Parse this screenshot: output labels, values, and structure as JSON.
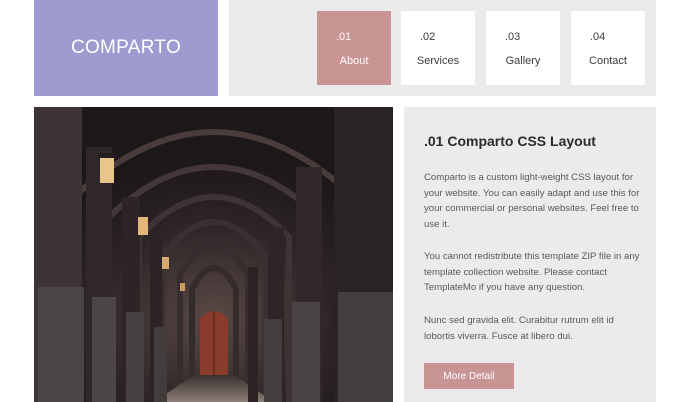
{
  "logo": {
    "text": "COMPARTO"
  },
  "nav": {
    "items": [
      {
        "number": ".01",
        "label": "About",
        "active": true
      },
      {
        "number": ".02",
        "label": "Services",
        "active": false
      },
      {
        "number": ".03",
        "label": "Gallery",
        "active": false
      },
      {
        "number": ".04",
        "label": "Contact",
        "active": false
      }
    ]
  },
  "content": {
    "title": ".01 Comparto CSS Layout",
    "paragraphs": [
      "Comparto is a custom light-weight CSS layout for your website. You can easily adapt and use this for your commercial or personal websites. Feel free to use it.",
      "You cannot redistribute this template ZIP file in any template collection website. Please contact TemplateMo if you have any question.",
      "Nunc sed gravida elit. Curabitur rutrum elit id lobortis viverra. Fusce at libero dui."
    ],
    "button_label": "More Detail"
  },
  "colors": {
    "logo_bg": "#9e9bd0",
    "accent": "#c99494",
    "panel_bg": "#ebebee"
  }
}
